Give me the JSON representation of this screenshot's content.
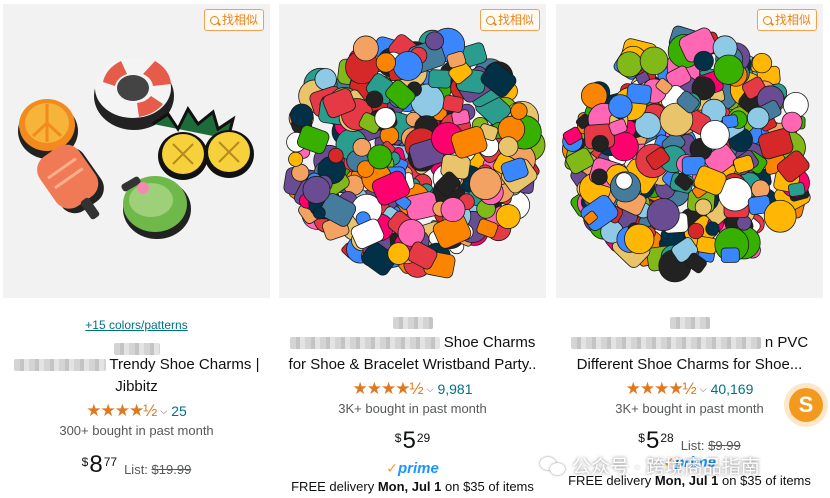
{
  "accent": "#de7921",
  "link_color": "#007185",
  "products": [
    {
      "similar_label": "找相似",
      "colors_link": "+15 colors/patterns",
      "title_line1": "Trendy Shoe Charms |",
      "title_line2": "Jibbitz",
      "rating": 4.5,
      "stars": "★★★★½",
      "review_count": "25",
      "bought": "300+ bought in past month",
      "price_symbol": "$",
      "price_whole": "8",
      "price_fraction": "77",
      "list_label": "List:",
      "list_price": "$19.99"
    },
    {
      "similar_label": "找相似",
      "title_line1": "Shoe Charms",
      "title_line2": "for Shoe & Bracelet Wristband Party..",
      "rating": 4.5,
      "stars": "★★★★½",
      "review_count": "9,981",
      "bought": "3K+ bought in past month",
      "price_symbol": "$",
      "price_whole": "5",
      "price_fraction": "29",
      "prime": "prime",
      "delivery_prefix": "FREE delivery",
      "delivery_date": "Mon, Jul 1",
      "delivery_suffix": "on $35 of items"
    },
    {
      "similar_label": "找相似",
      "title_line1": "n PVC",
      "title_line2": "Different Shoe Charms for Shoe...",
      "rating": 4.5,
      "stars": "★★★★½",
      "review_count": "40,169",
      "bought": "3K+ bought in past month",
      "price_symbol": "$",
      "price_whole": "5",
      "price_fraction": "28",
      "list_label": "List:",
      "list_price": "$9.99",
      "prime": "prime",
      "delivery_prefix": "FREE delivery",
      "delivery_date": "Mon, Jul 1",
      "delivery_suffix": "on $35 of items"
    }
  ],
  "watermark": "公众号 · 跨境商品指南",
  "badge_letter": "S"
}
